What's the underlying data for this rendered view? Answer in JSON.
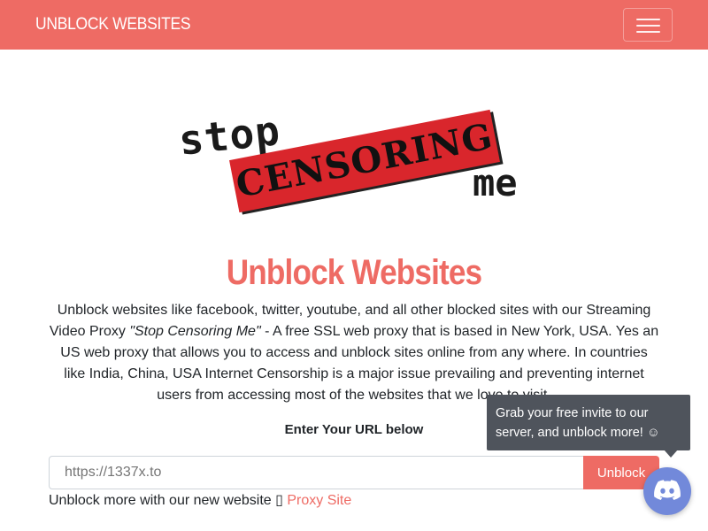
{
  "navbar": {
    "brand": "UNBLOCK WEBSITES",
    "toggle_icon": "hamburger-menu-icon",
    "accent_color": "#ee6b64"
  },
  "logo": {
    "line1": "stop",
    "line2": "CENSORING",
    "line3": "me"
  },
  "main": {
    "heading": "Unblock Websites",
    "description_before": "Unblock websites like facebook, twitter, youtube, and all other blocked sites with our Streaming Video Proxy ",
    "description_quote": "\"Stop Censoring Me\"",
    "description_after": " - A free SSL web proxy that is based in New York, USA. Yes an US web proxy that allows you to access and unblock sites online from any where. In countries like India, China, USA Internet Censorship is a major issue prevailing and preventing internet users from accessing most of the websites that we love to visit.",
    "url_label": "Enter Your URL below",
    "url_placeholder": "https://1337x.to",
    "unblock_button": "Unblock",
    "more_text": "Unblock more with our new website ▯ ",
    "more_link": "Proxy Site"
  },
  "discord_widget": {
    "tooltip": "Grab your free invite to our server, and unblock more! ☺",
    "icon": "discord-icon",
    "color": "#7289da"
  }
}
